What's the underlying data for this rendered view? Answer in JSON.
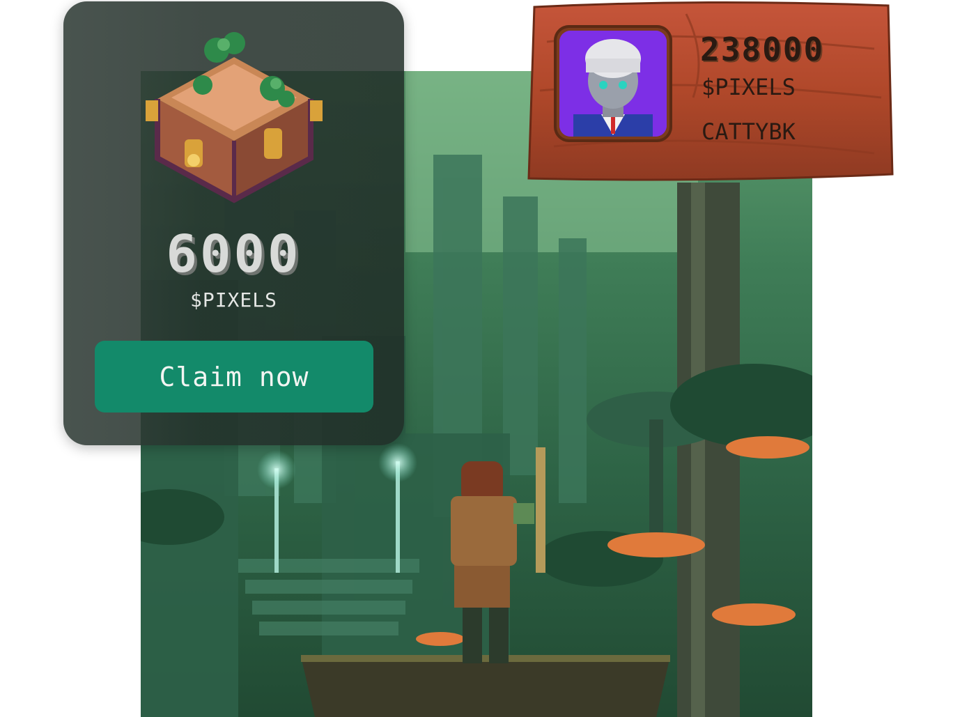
{
  "reward_card": {
    "amount": "6000",
    "currency": "$PIXELS",
    "claim_label": "Claim now",
    "chest_icon": "treasure-chest-icon"
  },
  "wallet": {
    "balance": "238000",
    "currency": "$PIXELS",
    "username": "CATTYBK",
    "avatar_icon": "player-avatar"
  },
  "colors": {
    "card_bg": "#212d28",
    "claim_button": "#138a6a",
    "wood": "#b0482a",
    "avatar_bg": "#7d2fe6"
  }
}
